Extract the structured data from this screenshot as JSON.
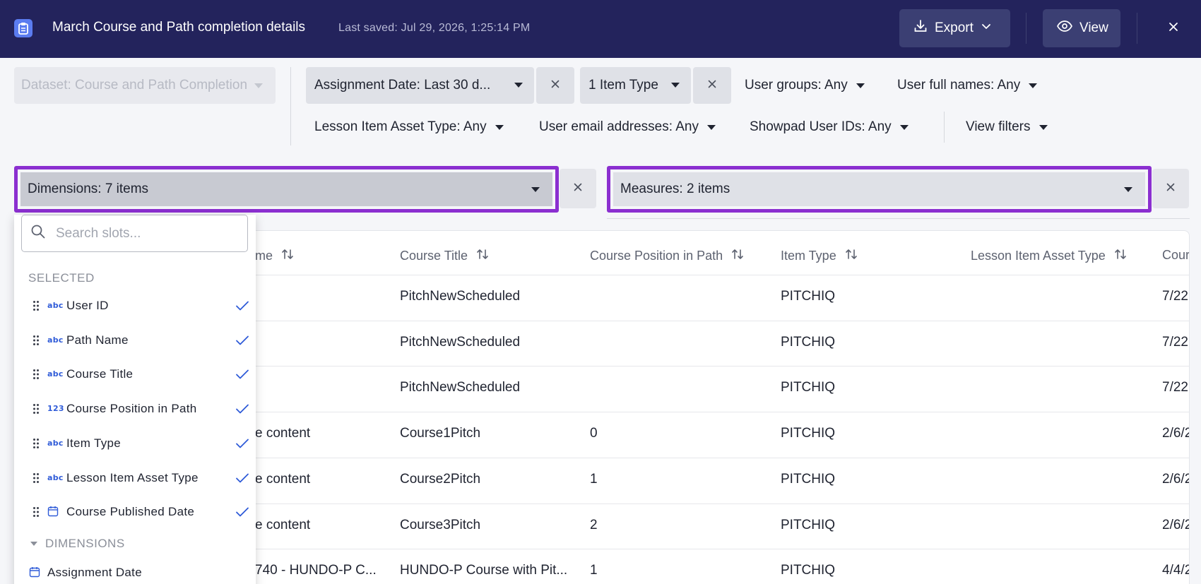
{
  "header": {
    "title": "March Course and Path completion details",
    "last_saved": "Last saved: Jul 29, 2026, 1:25:14 PM",
    "export_label": "Export",
    "view_label": "View"
  },
  "filters": {
    "dataset": "Dataset: Course and Path Completion",
    "assignment_date": "Assignment Date: Last 30 d...",
    "item_type": "1 Item Type",
    "user_groups": "User groups: Any",
    "user_full_names": "User full names: Any",
    "lesson_item_asset_type": "Lesson Item Asset Type: Any",
    "user_email_addresses": "User email addresses: Any",
    "showpad_user_ids": "Showpad User IDs: Any",
    "view_filters": "View filters"
  },
  "slots": {
    "dimensions": "Dimensions: 7 items",
    "measures": "Measures: 2 items"
  },
  "dropdown": {
    "search_placeholder": "Search slots...",
    "selected_label": "SELECTED",
    "selected_items": [
      {
        "label": "User ID",
        "type": "abc"
      },
      {
        "label": "Path Name",
        "type": "abc"
      },
      {
        "label": "Course Title",
        "type": "abc"
      },
      {
        "label": "Course Position in Path",
        "type": "123"
      },
      {
        "label": "Item Type",
        "type": "abc"
      },
      {
        "label": "Lesson Item Asset Type",
        "type": "abc"
      },
      {
        "label": "Course Published Date",
        "type": "calendar"
      }
    ],
    "dimensions_label": "DIMENSIONS",
    "dimension_items": [
      {
        "label": "Assignment Date",
        "type": "calendar"
      }
    ]
  },
  "table": {
    "columns": [
      "me",
      "Course Title",
      "Course Position in Path",
      "Item Type",
      "Lesson Item Asset Type",
      "Cour"
    ],
    "rows": [
      {
        "name": "",
        "course_title": "PitchNewScheduled",
        "position": "",
        "item_type": "PITCHIQ",
        "asset_type": "",
        "published": "7/22,"
      },
      {
        "name": "",
        "course_title": "PitchNewScheduled",
        "position": "",
        "item_type": "PITCHIQ",
        "asset_type": "",
        "published": "7/22,"
      },
      {
        "name": "",
        "course_title": "PitchNewScheduled",
        "position": "",
        "item_type": "PITCHIQ",
        "asset_type": "",
        "published": "7/22,"
      },
      {
        "name": "e content",
        "course_title": "Course1Pitch",
        "position": "0",
        "item_type": "PITCHIQ",
        "asset_type": "",
        "published": "2/6/2"
      },
      {
        "name": "e content",
        "course_title": "Course2Pitch",
        "position": "1",
        "item_type": "PITCHIQ",
        "asset_type": "",
        "published": "2/6/2"
      },
      {
        "name": "e content",
        "course_title": "Course3Pitch",
        "position": "2",
        "item_type": "PITCHIQ",
        "asset_type": "",
        "published": "2/6/2"
      },
      {
        "name": "740 - HUNDO-P C...",
        "course_title": "HUNDO-P Course with Pit...",
        "position": "1",
        "item_type": "PITCHIQ",
        "asset_type": "",
        "published": "4/4/2"
      }
    ]
  },
  "colors": {
    "header_bg": "#23235c",
    "accent_outline": "#8b2fd0",
    "check": "#2f5bd8"
  }
}
